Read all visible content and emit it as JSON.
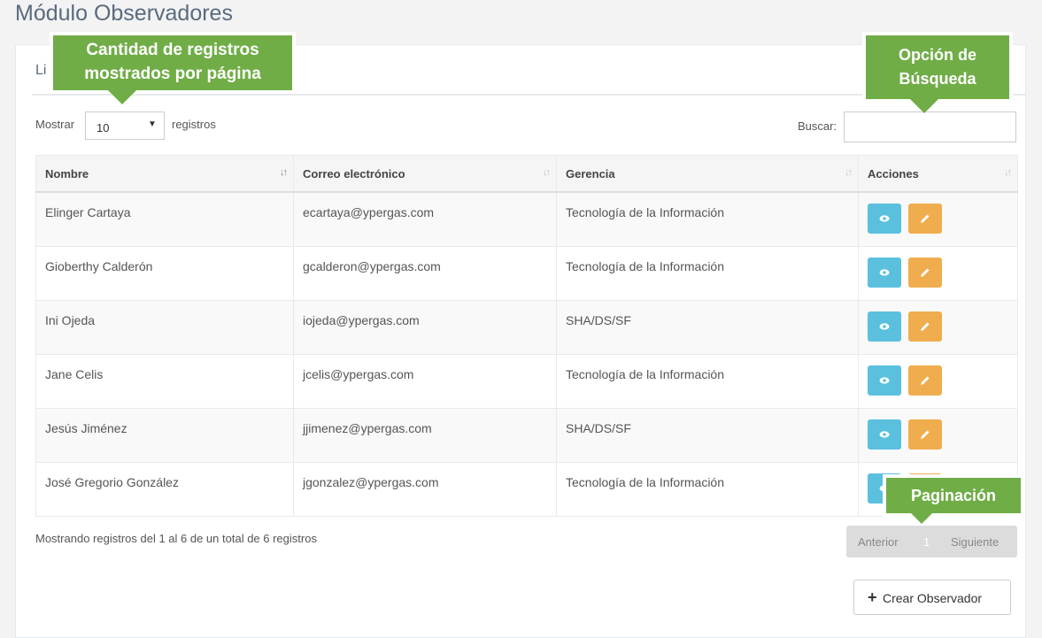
{
  "page": {
    "title": "Módulo Observadores"
  },
  "card": {
    "title": "Li"
  },
  "length": {
    "prefix": "Mostrar",
    "value": "10",
    "suffix": "registros"
  },
  "search": {
    "label": "Buscar:",
    "value": ""
  },
  "table": {
    "headers": [
      "Nombre",
      "Correo electrónico",
      "Gerencia",
      "Acciones"
    ],
    "rows": [
      {
        "nombre": "Elinger Cartaya",
        "correo": "ecartaya@ypergas.com",
        "gerencia": "Tecnología de la Información"
      },
      {
        "nombre": "Gioberthy Calderón",
        "correo": "gcalderon@ypergas.com",
        "gerencia": "Tecnología de la Información"
      },
      {
        "nombre": "Ini Ojeda",
        "correo": "iojeda@ypergas.com",
        "gerencia": "SHA/DS/SF"
      },
      {
        "nombre": "Jane Celis",
        "correo": "jcelis@ypergas.com",
        "gerencia": "Tecnología de la Información"
      },
      {
        "nombre": "Jesús Jiménez",
        "correo": "jjimenez@ypergas.com",
        "gerencia": "SHA/DS/SF"
      },
      {
        "nombre": "José Gregorio González",
        "correo": "jgonzalez@ypergas.com",
        "gerencia": "Tecnología de la Información"
      }
    ],
    "action_icons": [
      "eye-icon",
      "pencil-icon"
    ]
  },
  "info": "Mostrando registros del 1 al 6 de un total de 6 registros",
  "pagination": {
    "prev": "Anterior",
    "current": "1",
    "next": "Siguiente"
  },
  "create_button": {
    "label": "Crear Observador",
    "icon": "plus-icon"
  },
  "callouts": {
    "length_line1": "Cantidad de registros",
    "length_line2": "mostrados por página",
    "search_line1": "Opción de",
    "search_line2": "Búsqueda",
    "pager": "Paginación"
  },
  "colors": {
    "callout": "#70ad47",
    "view_button": "#5bc0de",
    "edit_button": "#f0ad4e"
  }
}
